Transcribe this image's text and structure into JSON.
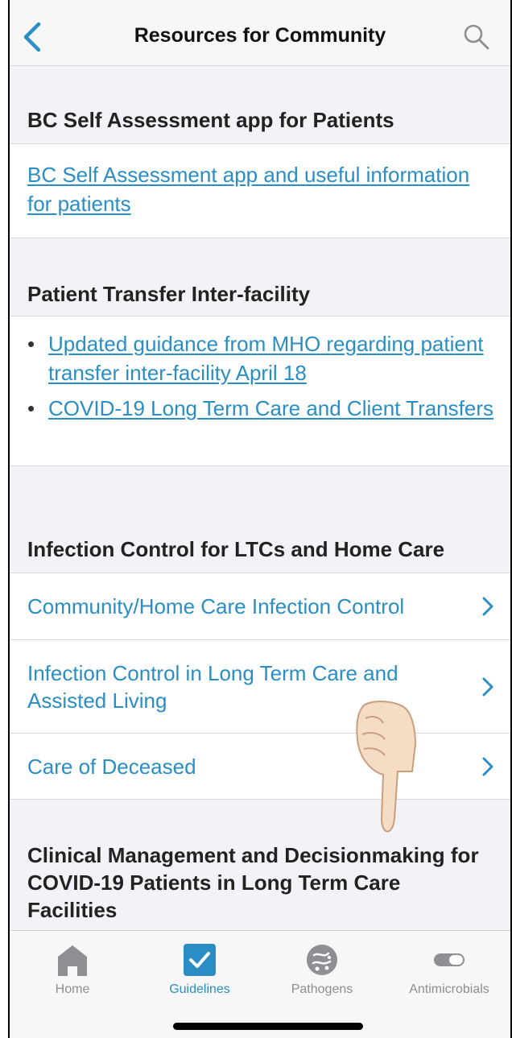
{
  "nav": {
    "title": "Resources for Community"
  },
  "sections": [
    {
      "header": "BC Self Assessment app for Patients",
      "link": "BC Self Assessment app and useful information for patients"
    },
    {
      "header": "Patient Transfer Inter-facility",
      "bullets": [
        "Updated guidance from MHO regarding patient transfer  inter-facility April 18",
        "COVID-19 Long Term Care and Client Transfers"
      ]
    },
    {
      "header": "Infection Control for LTCs and Home Care",
      "rows": [
        "Community/Home Care Infection Control",
        "Infection Control in Long Term Care and Assisted Living",
        "Care of Deceased"
      ]
    },
    {
      "header": "Clinical Management and Decisionmaking for COVID-19 Patients in Long Term Care Facilities"
    }
  ],
  "tabs": [
    {
      "label": "Home",
      "icon": "house-icon",
      "active": false
    },
    {
      "label": "Guidelines",
      "icon": "checkbox-icon",
      "active": true
    },
    {
      "label": "Pathogens",
      "icon": "pathogen-icon",
      "active": false
    },
    {
      "label": "Antimicrobials",
      "icon": "pill-icon",
      "active": false
    }
  ],
  "colors": {
    "accent": "#2a8ec4",
    "tab_inactive": "#8e8e93",
    "background": "#f2f2f7"
  }
}
